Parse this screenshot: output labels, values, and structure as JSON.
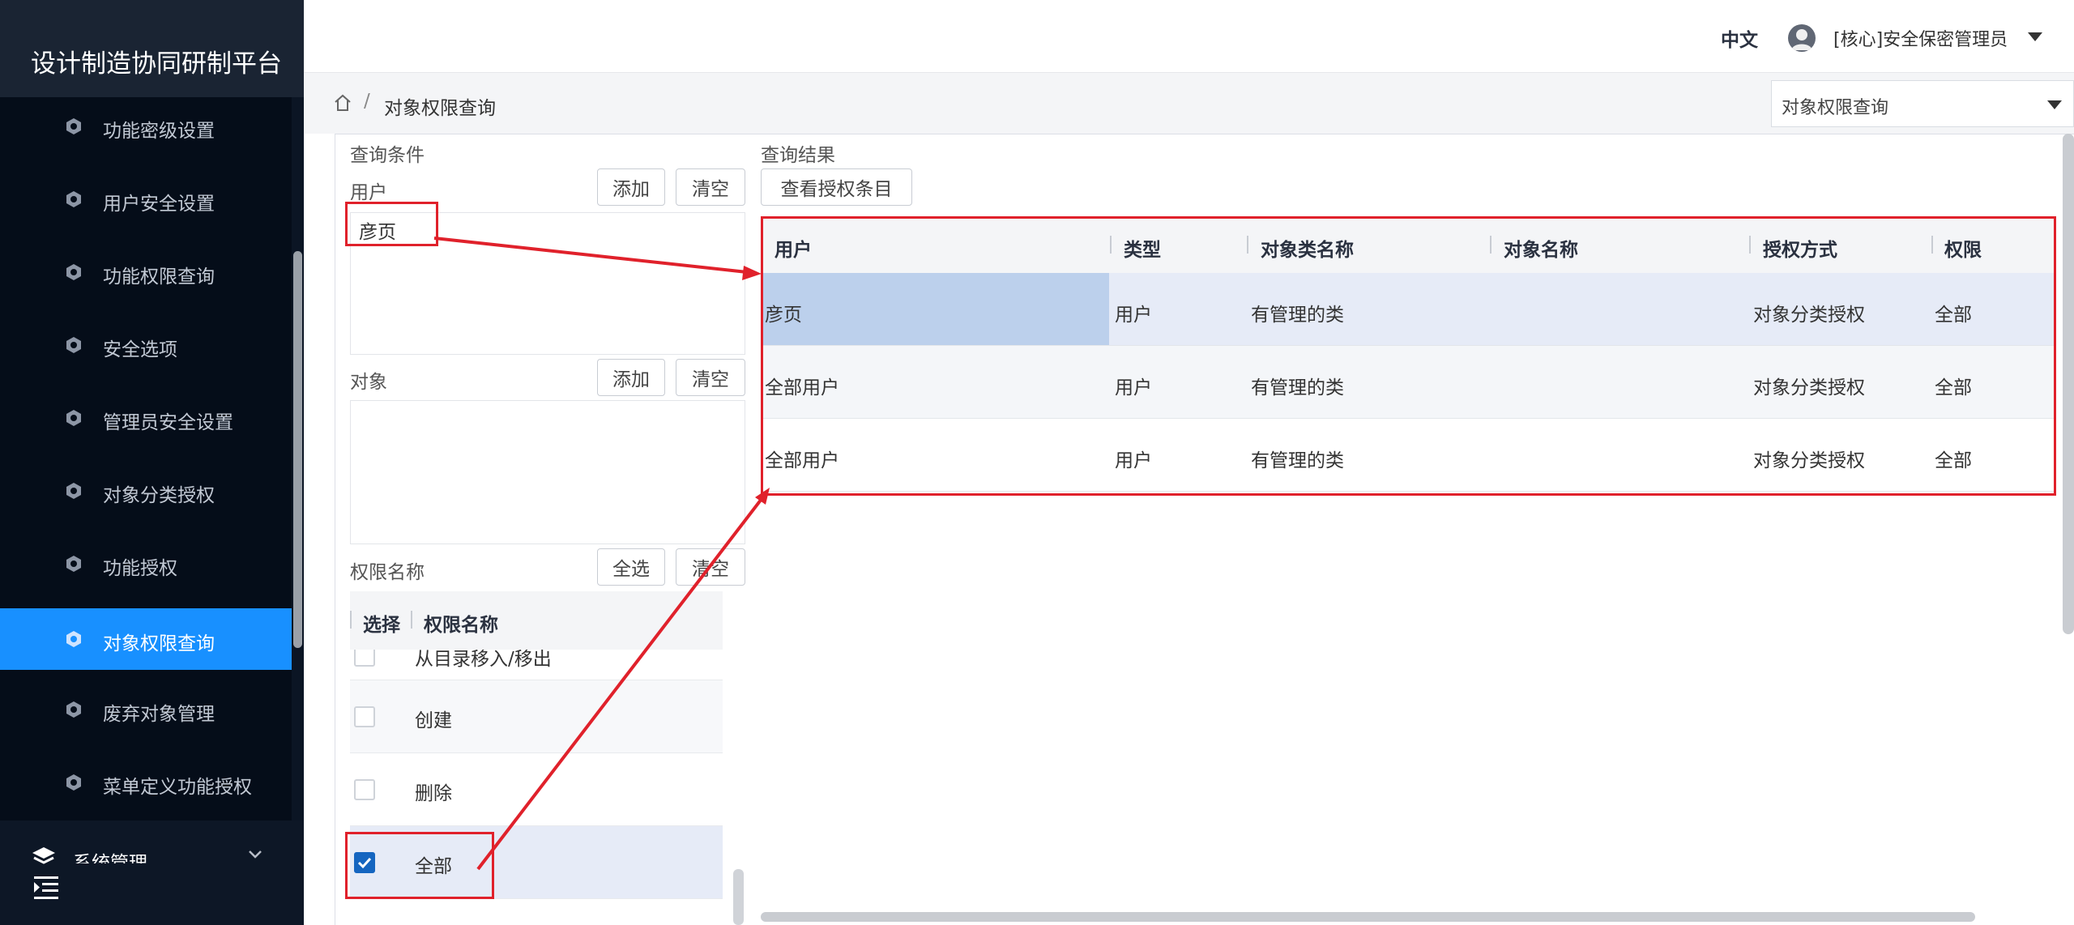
{
  "app": {
    "title": "设计制造协同研制平台"
  },
  "sidebar": {
    "items": [
      {
        "label": "功能密级设置",
        "icon": "shield-gear-icon"
      },
      {
        "label": "用户安全设置",
        "icon": "shield-gear-icon"
      },
      {
        "label": "功能权限查询",
        "icon": "shield-gear-icon"
      },
      {
        "label": "安全选项",
        "icon": "shield-gear-icon"
      },
      {
        "label": "管理员安全设置",
        "icon": "shield-gear-icon"
      },
      {
        "label": "对象分类授权",
        "icon": "shield-gear-icon"
      },
      {
        "label": "功能授权",
        "icon": "shield-gear-icon"
      },
      {
        "label": "对象权限查询",
        "icon": "shield-gear-icon",
        "active": true
      },
      {
        "label": "废弃对象管理",
        "icon": "shield-gear-icon"
      },
      {
        "label": "菜单定义功能授权",
        "icon": "shield-gear-icon"
      }
    ],
    "group": {
      "label": "系统管理",
      "icon": "layers-icon"
    },
    "collapse_icon": "menu-collapse-icon"
  },
  "header": {
    "language": "中文",
    "user": "[核心]安全保密管理员",
    "avatar_icon": "user-avatar-icon"
  },
  "breadcrumb": {
    "home_icon": "home-icon",
    "separator": "/",
    "current": "对象权限查询"
  },
  "page_selector": {
    "value": "对象权限查询"
  },
  "query": {
    "title": "查询条件",
    "user": {
      "label": "用户",
      "add": "添加",
      "clear": "清空",
      "entries": [
        "彦页"
      ]
    },
    "object": {
      "label": "对象",
      "add": "添加",
      "clear": "清空",
      "entries": []
    },
    "permission": {
      "label": "权限名称",
      "select_all": "全选",
      "clear": "清空",
      "headers": {
        "select": "选择",
        "name": "权限名称"
      },
      "rows": [
        {
          "name": "从目录移入/移出",
          "checked": false
        },
        {
          "name": "创建",
          "checked": false
        },
        {
          "name": "删除",
          "checked": false
        },
        {
          "name": "全部",
          "checked": true
        }
      ]
    }
  },
  "result": {
    "title": "查询结果",
    "view_button": "查看授权条目",
    "columns": [
      "用户",
      "类型",
      "对象类名称",
      "对象名称",
      "授权方式",
      "权限"
    ],
    "rows": [
      {
        "user": "彦页",
        "type": "用户",
        "class_name": "有管理的类",
        "object_name": "",
        "auth_method": "对象分类授权",
        "permission": "全部"
      },
      {
        "user": "全部用户",
        "type": "用户",
        "class_name": "有管理的类",
        "object_name": "",
        "auth_method": "对象分类授权",
        "permission": "全部"
      },
      {
        "user": "全部用户",
        "type": "用户",
        "class_name": "有管理的类",
        "object_name": "",
        "auth_method": "对象分类授权",
        "permission": "全部"
      }
    ]
  },
  "colors": {
    "sidebar_bg": "#050d19",
    "active_item": "#1890ff",
    "annotation_red": "#e0212b",
    "selected_row": "#e6ebf7",
    "highlight_cell": "#bcd0ec",
    "checkbox_checked": "#1565c0"
  }
}
